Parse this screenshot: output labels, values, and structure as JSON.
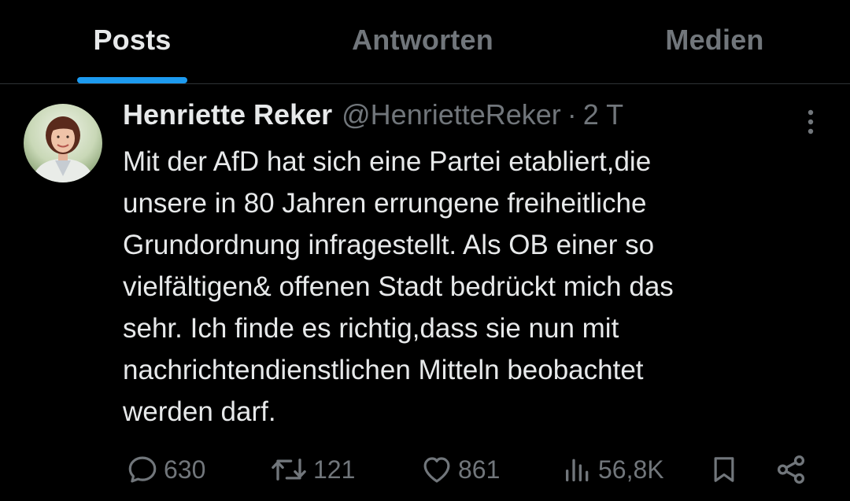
{
  "tabs": [
    {
      "label": "Posts",
      "active": true
    },
    {
      "label": "Antworten",
      "active": false
    },
    {
      "label": "Medien",
      "active": false
    }
  ],
  "accent_color": "#1d9bf0",
  "tweet": {
    "author_name": "Henriette Reker",
    "handle": "@HenrietteReker",
    "separator": "·",
    "time": "2 T",
    "text": "Mit der AfD hat sich eine Partei etabliert,die\nunsere in 80 Jahren errungene freiheitliche\nGrundordnung infragestellt. Als OB einer so\nvielfältigen& offenen Stadt bedrückt mich das\nsehr. Ich finde es richtig,dass sie nun mit\nnachrichtendienstlichen Mitteln beobachtet\nwerden darf.",
    "actions": {
      "replies": "630",
      "reposts": "121",
      "likes": "861",
      "views": "56,8K"
    },
    "icons": [
      "reply-icon",
      "repost-icon",
      "like-icon",
      "views-icon",
      "bookmark-icon",
      "share-icon",
      "more-icon"
    ]
  }
}
